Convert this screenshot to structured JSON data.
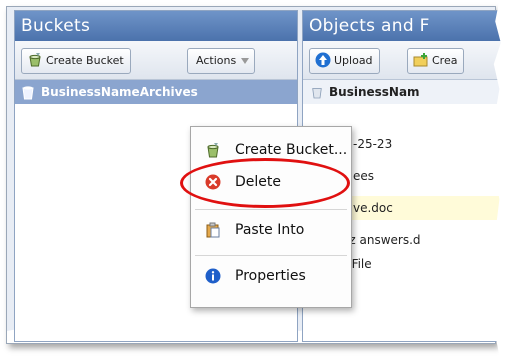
{
  "buckets_panel": {
    "title": "Buckets",
    "create_bucket_label": "Create Bucket",
    "actions_label": "Actions",
    "selected_bucket": "BusinessNameArchives"
  },
  "objects_panel": {
    "title": "Objects and F",
    "upload_label": "Upload",
    "create_label": "Crea",
    "breadcrumb": "BusinessNam",
    "files": [
      {
        "name": "-25-23"
      },
      {
        "name": "ees"
      },
      {
        "name": "ve.doc"
      },
      {
        "name": "Quiz answers.d"
      },
      {
        "name": "Th..File"
      }
    ]
  },
  "context_menu": {
    "items": [
      {
        "label": "Create Bucket..."
      },
      {
        "label": "Delete"
      },
      {
        "label": "Paste Into"
      },
      {
        "label": "Properties"
      }
    ]
  },
  "colors": {
    "header_blue": "#4b72ac",
    "selection_blue": "#8ba5cf",
    "highlight_circle": "#e01010",
    "delete_icon_red": "#d93b2a",
    "properties_icon_blue": "#1f5fc9"
  }
}
